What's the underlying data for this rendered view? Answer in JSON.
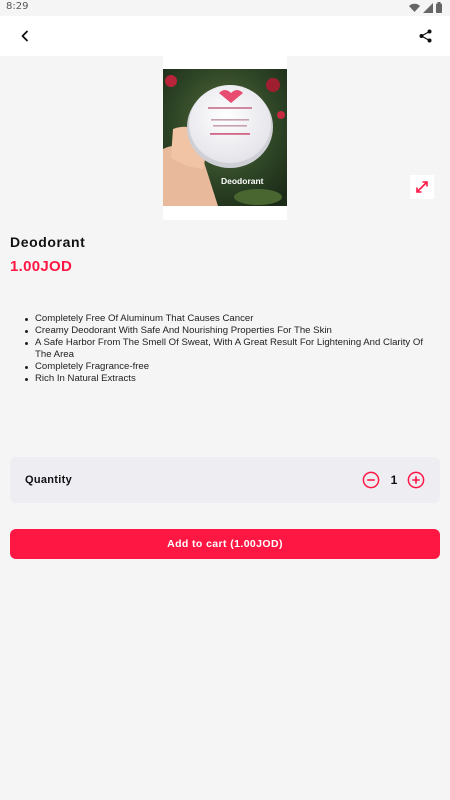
{
  "status_bar": {
    "time": "8:29",
    "icons": [
      "wifi-icon",
      "signal-icon",
      "battery-icon"
    ]
  },
  "app_bar": {
    "back_icon": "chevron-left-icon",
    "share_icon": "share-icon"
  },
  "product": {
    "image_caption": "Deodorant",
    "name": "Deodorant",
    "price": "1.00JOD",
    "features": [
      "Completely Free Of Aluminum That Causes Cancer",
      "Creamy Deodorant With Safe And Nourishing Properties For The Skin",
      "A Safe Harbor From The Smell Of Sweat, With A Great Result For Lightening And Clarity Of The Area",
      "Completely Fragrance-free",
      "Rich In Natural Extracts"
    ]
  },
  "quantity": {
    "label": "Quantity",
    "value": "1"
  },
  "cart": {
    "button_label": "Add to cart (1.00JOD)"
  },
  "colors": {
    "accent": "#ff1744",
    "background": "#f5f5f5",
    "card": "#eeedf2"
  }
}
